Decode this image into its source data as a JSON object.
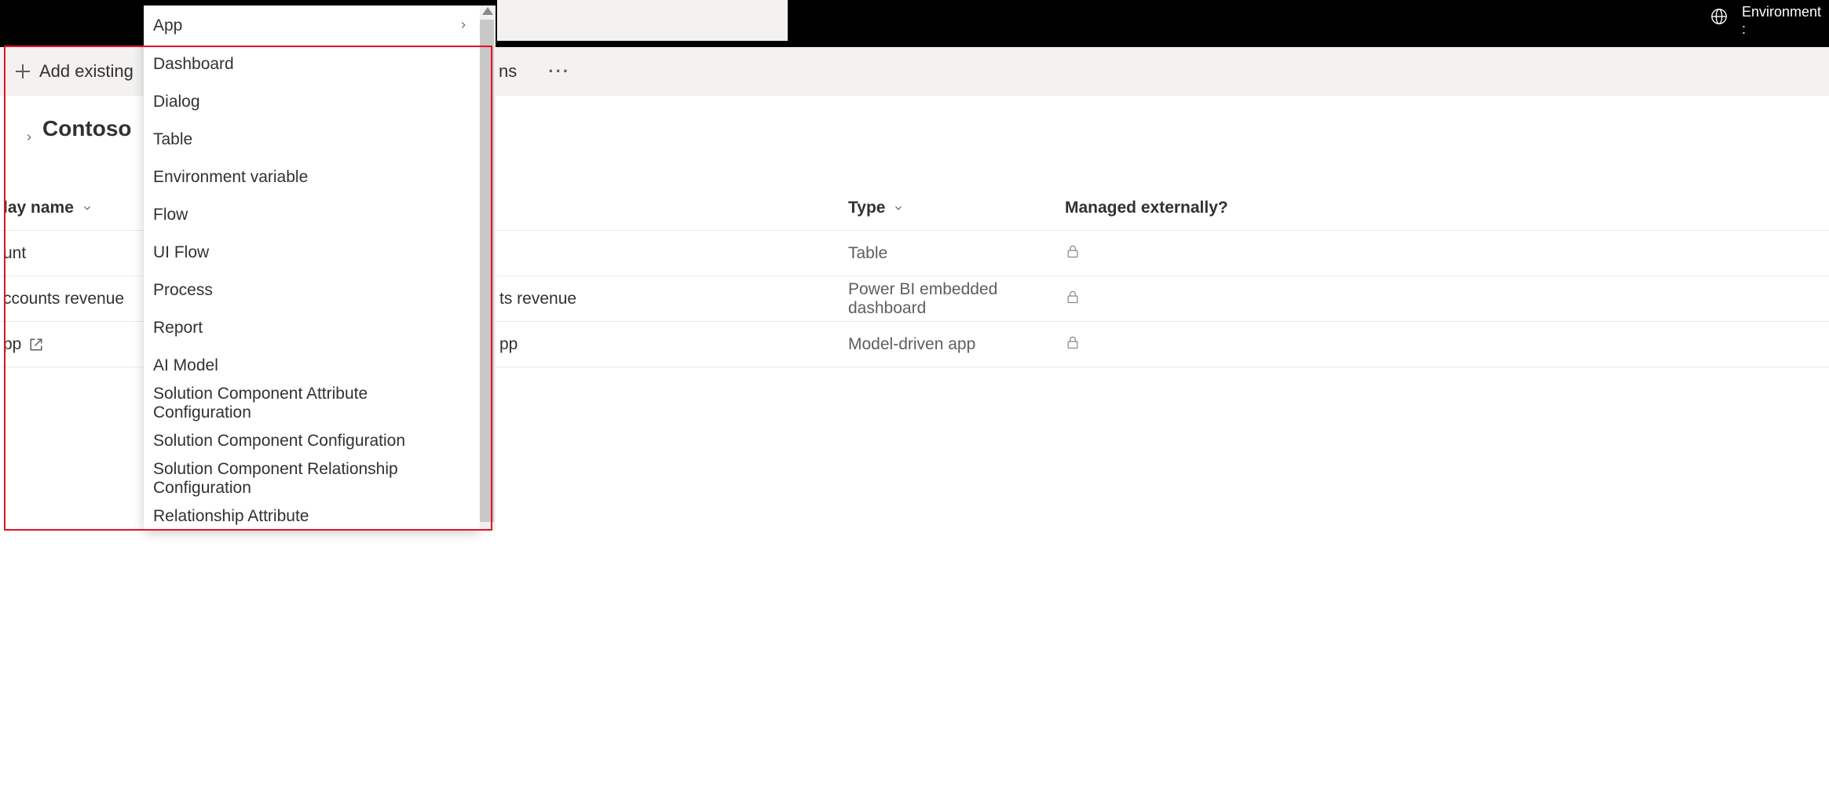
{
  "topbar": {
    "env_label": "Environment"
  },
  "commandbar": {
    "add_existing": "Add existing",
    "tail_fragment": "ns",
    "overflow": "···"
  },
  "page": {
    "title": "Contoso"
  },
  "columns": {
    "display_name": "lay name",
    "type": "Type",
    "managed": "Managed externally?"
  },
  "rows": [
    {
      "name": "unt",
      "name_right": "",
      "type": "Table",
      "locked": true,
      "link_out": false
    },
    {
      "name": "ccounts revenue",
      "name_right": "ts revenue",
      "type": "Power BI embedded dashboard",
      "locked": true,
      "link_out": false
    },
    {
      "name": "pp",
      "name_right": "pp",
      "type": "Model-driven app",
      "locked": true,
      "link_out": true
    }
  ],
  "menu": {
    "items": [
      {
        "label": "App",
        "submenu": true
      },
      {
        "label": "Dashboard"
      },
      {
        "label": "Dialog"
      },
      {
        "label": "Table"
      },
      {
        "label": "Environment variable"
      },
      {
        "label": "Flow"
      },
      {
        "label": "UI Flow"
      },
      {
        "label": "Process"
      },
      {
        "label": "Report"
      },
      {
        "label": "AI Model"
      },
      {
        "label": "Solution Component Attribute Configuration"
      },
      {
        "label": "Solution Component Configuration"
      },
      {
        "label": "Solution Component Relationship Configuration"
      },
      {
        "label": "Relationship Attribute"
      }
    ]
  }
}
